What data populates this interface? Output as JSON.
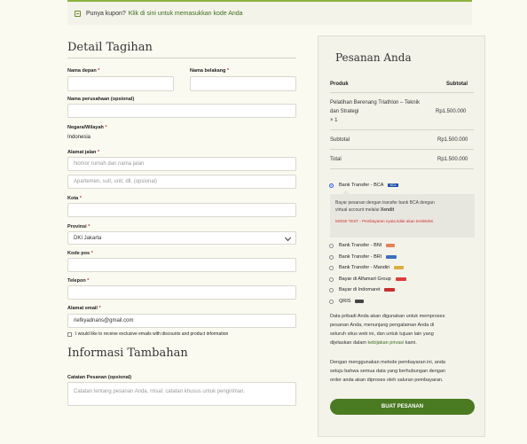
{
  "coupon": {
    "text": "Punya kupon?",
    "link": "Klik di sini untuk memasukkan kode Anda"
  },
  "billing": {
    "title": "Detail Tagihan",
    "first_name": {
      "label": "Nama depan",
      "value": ""
    },
    "last_name": {
      "label": "Nama belakang",
      "value": ""
    },
    "company": {
      "label": "Nama perusahaan (opsional)",
      "value": ""
    },
    "country": {
      "label": "Negara/Wilayah",
      "value": "Indonesia"
    },
    "street": {
      "label": "Alamat jalan",
      "placeholder1": "Nomor rumah dan nama jalan",
      "placeholder2": "Apartemen, suit, unit, dll. (opsional)"
    },
    "city": {
      "label": "Kota",
      "value": ""
    },
    "province": {
      "label": "Provinsi",
      "value": "DKI Jakarta"
    },
    "postcode": {
      "label": "Kode pos",
      "value": ""
    },
    "phone": {
      "label": "Telepon",
      "value": ""
    },
    "email": {
      "label": "Alamat email",
      "value": "riefkyadnans@gmail.com"
    },
    "marketing": "I would like to receive exclusive emails with discounts and product information",
    "required_mark": "*"
  },
  "additional": {
    "title": "Informasi Tambahan",
    "notes_label": "Catatan Pesanan (opsional)",
    "notes_placeholder": "Catatan tentang pesanan Anda, misal: catatan khusus untuk pengiriman."
  },
  "order": {
    "title": "Pesanan Anda",
    "col_product": "Produk",
    "col_subtotal": "Subtotal",
    "item_name_1": "Pelatihan Berenang Triathlon – Teknik",
    "item_name_2": "dan Strategi",
    "item_qty": "× 1",
    "item_price": "Rp1.500.000",
    "subtotal_label": "Subtotal",
    "subtotal_value": "Rp1.500.000",
    "total_label": "Total",
    "total_value": "Rp1.500.000"
  },
  "payment": {
    "selected": "Bank Transfer - BCA",
    "selected_logo": "BCA",
    "desc_1": "Bayar pesanan dengan transfer bank BCA dengan",
    "desc_2": "virtual account melalui",
    "desc_strong": "Xendit",
    "mode": "MODE TEST - Pembayaran nyata tidak akan terdeteksi",
    "methods": [
      {
        "label": "Bank Transfer - BNI",
        "logo": "BNI"
      },
      {
        "label": "Bank Transfer - BRI",
        "logo": "BRI"
      },
      {
        "label": "Bank Transfer - Mandiri",
        "logo": "mandiri"
      },
      {
        "label": "Bayar di Alfamart Group",
        "logo": "Alfamart"
      },
      {
        "label": "Bayar di Indomaret",
        "logo": "Indomaret"
      },
      {
        "label": "QRIS",
        "logo": "QRIS"
      }
    ]
  },
  "privacy": {
    "text_1": "Data pribadi Anda akan digunakan untuk memproses",
    "text_2": "pesanan Anda, menunjang pengalaman Anda di",
    "text_3": "seluruh situs web ini, dan untuk tujuan lain yang",
    "text_4": "dijelaskan dalam",
    "link": "kebijakan privasi",
    "text_5": "kami."
  },
  "terms": {
    "line_1": "Dengan menggunakan metode pembayaran ini, anda",
    "line_2": "setuju bahwa semua data yang berhubungan dengan",
    "line_3": "order anda akan diproses oleh saluran pembayaran."
  },
  "place_order": "BUAT PESANAN",
  "colors": {
    "accent": "#4a7a22",
    "background": "#fbfaf1",
    "panel": "#f4f3ea",
    "required": "#c0392b"
  }
}
